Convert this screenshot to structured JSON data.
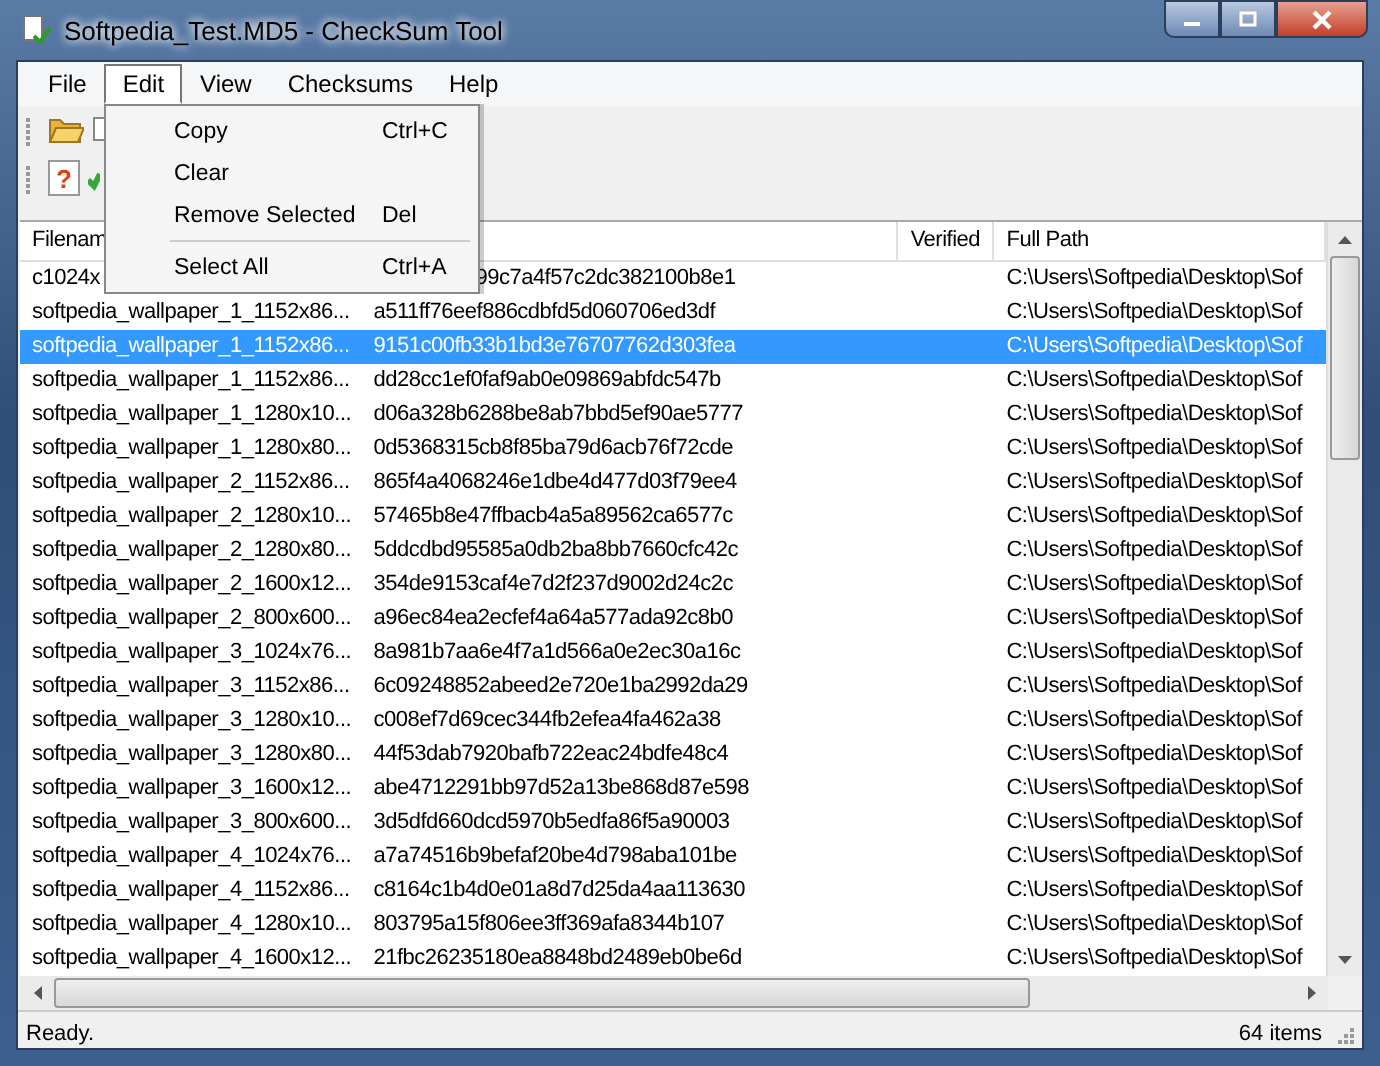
{
  "window": {
    "title": "Softpedia_Test.MD5 - CheckSum Tool"
  },
  "menu_bar": [
    {
      "label": "File",
      "selected": false
    },
    {
      "label": "Edit",
      "selected": true
    },
    {
      "label": "View",
      "selected": false
    },
    {
      "label": "Checksums",
      "selected": false
    },
    {
      "label": "Help",
      "selected": false
    }
  ],
  "edit_menu": [
    {
      "label": "Copy",
      "shortcut": "Ctrl+C",
      "separator_before": false
    },
    {
      "label": "Clear",
      "separator_before": false
    },
    {
      "label": "Remove Selected",
      "shortcut": "Del",
      "separator_before": false
    },
    {
      "label": "Select All",
      "shortcut": "Ctrl+A",
      "separator_before": true
    }
  ],
  "toolbar": {
    "help_glyph": "?"
  },
  "table": {
    "header": {
      "column_1": "Filenam",
      "column_3": "Verified",
      "column_4": "Full Path"
    },
    "rows": [
      {
        "filename": "c1024x",
        "checksum": "99c7a4f57c2dc382100b8e1",
        "path": "C:\\Users\\Softpedia\\Desktop\\Sof",
        "selected": false
      },
      {
        "filename": "softpedia_wallpaper_1_1152x86...",
        "checksum": "a511ff76eef886cdbfd5d060706ed3df",
        "path": "C:\\Users\\Softpedia\\Desktop\\Sof",
        "selected": false
      },
      {
        "filename": "softpedia_wallpaper_1_1152x86...",
        "checksum": "9151c00fb33b1bd3e76707762d303fea",
        "path": "C:\\Users\\Softpedia\\Desktop\\Sof",
        "selected": true
      },
      {
        "filename": "softpedia_wallpaper_1_1152x86...",
        "checksum": "dd28cc1ef0faf9ab0e09869abfdc547b",
        "path": "C:\\Users\\Softpedia\\Desktop\\Sof",
        "selected": false
      },
      {
        "filename": "softpedia_wallpaper_1_1280x10...",
        "checksum": "d06a328b6288be8ab7bbd5ef90ae5777",
        "path": "C:\\Users\\Softpedia\\Desktop\\Sof",
        "selected": false
      },
      {
        "filename": "softpedia_wallpaper_1_1280x80...",
        "checksum": "0d5368315cb8f85ba79d6acb76f72cde",
        "path": "C:\\Users\\Softpedia\\Desktop\\Sof",
        "selected": false
      },
      {
        "filename": "softpedia_wallpaper_2_1152x86...",
        "checksum": "865f4a4068246e1dbe4d477d03f79ee4",
        "path": "C:\\Users\\Softpedia\\Desktop\\Sof",
        "selected": false
      },
      {
        "filename": "softpedia_wallpaper_2_1280x10...",
        "checksum": "57465b8e47ffbacb4a5a89562ca6577c",
        "path": "C:\\Users\\Softpedia\\Desktop\\Sof",
        "selected": false
      },
      {
        "filename": "softpedia_wallpaper_2_1280x80...",
        "checksum": "5ddcdbd95585a0db2ba8bb7660cfc42c",
        "path": "C:\\Users\\Softpedia\\Desktop\\Sof",
        "selected": false
      },
      {
        "filename": "softpedia_wallpaper_2_1600x12...",
        "checksum": "354de9153caf4e7d2f237d9002d24c2c",
        "path": "C:\\Users\\Softpedia\\Desktop\\Sof",
        "selected": false
      },
      {
        "filename": "softpedia_wallpaper_2_800x600...",
        "checksum": "a96ec84ea2ecfef4a64a577ada92c8b0",
        "path": "C:\\Users\\Softpedia\\Desktop\\Sof",
        "selected": false
      },
      {
        "filename": "softpedia_wallpaper_3_1024x76...",
        "checksum": "8a981b7aa6e4f7a1d566a0e2ec30a16c",
        "path": "C:\\Users\\Softpedia\\Desktop\\Sof",
        "selected": false
      },
      {
        "filename": "softpedia_wallpaper_3_1152x86...",
        "checksum": "6c09248852abeed2e720e1ba2992da29",
        "path": "C:\\Users\\Softpedia\\Desktop\\Sof",
        "selected": false
      },
      {
        "filename": "softpedia_wallpaper_3_1280x10...",
        "checksum": "c008ef7d69cec344fb2efea4fa462a38",
        "path": "C:\\Users\\Softpedia\\Desktop\\Sof",
        "selected": false
      },
      {
        "filename": "softpedia_wallpaper_3_1280x80...",
        "checksum": "44f53dab7920bafb722eac24bdfe48c4",
        "path": "C:\\Users\\Softpedia\\Desktop\\Sof",
        "selected": false
      },
      {
        "filename": "softpedia_wallpaper_3_1600x12...",
        "checksum": "abe4712291bb97d52a13be868d87e598",
        "path": "C:\\Users\\Softpedia\\Desktop\\Sof",
        "selected": false
      },
      {
        "filename": "softpedia_wallpaper_3_800x600...",
        "checksum": "3d5dfd660dcd5970b5edfa86f5a90003",
        "path": "C:\\Users\\Softpedia\\Desktop\\Sof",
        "selected": false
      },
      {
        "filename": "softpedia_wallpaper_4_1024x76...",
        "checksum": "a7a74516b9befaf20be4d798aba101be",
        "path": "C:\\Users\\Softpedia\\Desktop\\Sof",
        "selected": false
      },
      {
        "filename": "softpedia_wallpaper_4_1152x86...",
        "checksum": "c8164c1b4d0e01a8d7d25da4aa113630",
        "path": "C:\\Users\\Softpedia\\Desktop\\Sof",
        "selected": false
      },
      {
        "filename": "softpedia_wallpaper_4_1280x10...",
        "checksum": "803795a15f806ee3ff369afa8344b107",
        "path": "C:\\Users\\Softpedia\\Desktop\\Sof",
        "selected": false
      },
      {
        "filename": "softpedia_wallpaper_4_1600x12...",
        "checksum": "21fbc26235180ea8848bd2489eb0be6d",
        "path": "C:\\Users\\Softpedia\\Desktop\\Sof",
        "selected": false
      }
    ]
  },
  "status_bar": {
    "text": "Ready.",
    "count": "64 items"
  }
}
